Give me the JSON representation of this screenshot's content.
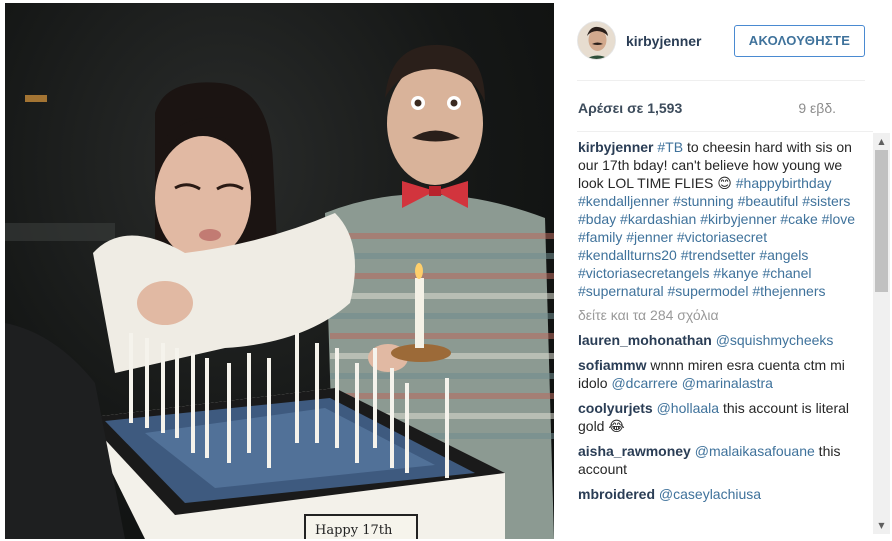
{
  "post": {
    "username": "kirbyjenner",
    "follow_label": "ΑΚΟΛΟΥΘΗΣΤΕ",
    "likes": "Αρέσει σε 1,593",
    "age": "9 εβδ.",
    "view_more": "δείτε και τα 284 σχόλια",
    "cake_text": "Happy 17th"
  },
  "caption": {
    "user": "kirbyjenner",
    "segments": [
      {
        "t": "tag",
        "v": "#TB"
      },
      {
        "t": "text",
        "v": " to cheesin hard with sis on our 17th bday! can't believe how young we look LOL TIME FLIES 😊 "
      },
      {
        "t": "tag",
        "v": "#happybirthday"
      },
      {
        "t": "text",
        "v": " "
      },
      {
        "t": "tag",
        "v": "#kendalljenner"
      },
      {
        "t": "text",
        "v": " "
      },
      {
        "t": "tag",
        "v": "#stunning"
      },
      {
        "t": "text",
        "v": " "
      },
      {
        "t": "tag",
        "v": "#beautiful"
      },
      {
        "t": "text",
        "v": " "
      },
      {
        "t": "tag",
        "v": "#sisters"
      },
      {
        "t": "text",
        "v": " "
      },
      {
        "t": "tag",
        "v": "#bday"
      },
      {
        "t": "text",
        "v": " "
      },
      {
        "t": "tag",
        "v": "#kardashian"
      },
      {
        "t": "text",
        "v": " "
      },
      {
        "t": "tag",
        "v": "#kirbyjenner"
      },
      {
        "t": "text",
        "v": " "
      },
      {
        "t": "tag",
        "v": "#cake"
      },
      {
        "t": "text",
        "v": " "
      },
      {
        "t": "tag",
        "v": "#love"
      },
      {
        "t": "text",
        "v": " "
      },
      {
        "t": "tag",
        "v": "#family"
      },
      {
        "t": "text",
        "v": " "
      },
      {
        "t": "tag",
        "v": "#jenner"
      },
      {
        "t": "text",
        "v": " "
      },
      {
        "t": "tag",
        "v": "#victoriasecret"
      },
      {
        "t": "text",
        "v": " "
      },
      {
        "t": "tag",
        "v": "#kendallturns20"
      },
      {
        "t": "text",
        "v": " "
      },
      {
        "t": "tag",
        "v": "#trendsetter"
      },
      {
        "t": "text",
        "v": " "
      },
      {
        "t": "tag",
        "v": "#angels"
      },
      {
        "t": "text",
        "v": " "
      },
      {
        "t": "tag",
        "v": "#victoriasecretangels"
      },
      {
        "t": "text",
        "v": " "
      },
      {
        "t": "tag",
        "v": "#kanye"
      },
      {
        "t": "text",
        "v": " "
      },
      {
        "t": "tag",
        "v": "#chanel"
      },
      {
        "t": "text",
        "v": " "
      },
      {
        "t": "tag",
        "v": "#supernatural"
      },
      {
        "t": "text",
        "v": " "
      },
      {
        "t": "tag",
        "v": "#supermodel"
      },
      {
        "t": "text",
        "v": " "
      },
      {
        "t": "tag",
        "v": "#thejenners"
      }
    ]
  },
  "comments": [
    {
      "user": "lauren_mohonathan",
      "segments": [
        {
          "t": "mention",
          "v": "@squishmycheeks"
        }
      ]
    },
    {
      "user": "sofiammw",
      "segments": [
        {
          "t": "text",
          "v": "wnnn miren esra cuenta ctm mi idolo "
        },
        {
          "t": "mention",
          "v": "@dcarrere"
        },
        {
          "t": "text",
          "v": " "
        },
        {
          "t": "mention",
          "v": "@marinalastra"
        }
      ]
    },
    {
      "user": "coolyurjets",
      "segments": [
        {
          "t": "mention",
          "v": "@hollaala"
        },
        {
          "t": "text",
          "v": " this account is literal gold 😂"
        }
      ]
    },
    {
      "user": "aisha_rawmoney",
      "segments": [
        {
          "t": "mention",
          "v": "@malaikasafouane"
        },
        {
          "t": "text",
          "v": " this account"
        }
      ]
    },
    {
      "user": "mbroidered",
      "segments": [
        {
          "t": "mention",
          "v": "@caseylachiusa"
        }
      ]
    }
  ],
  "icons": {
    "scroll_up": "▲",
    "scroll_down": "▼"
  },
  "colors": {
    "link": "#3f729b",
    "username": "#2a3d55",
    "follow_border": "#4a8ad1"
  }
}
